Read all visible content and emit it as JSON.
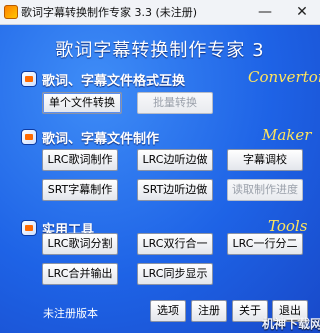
{
  "window": {
    "title": "歌词字幕转换制作专家 3.3 (未注册)",
    "minimize": "—",
    "close": "✕"
  },
  "app_title": "歌词字幕转换制作专家 3",
  "sections": {
    "convertor": {
      "label": "歌词、字幕文件格式互换",
      "english": "Convertor",
      "buttons": {
        "single": "单个文件转换",
        "batch": "批量转换"
      }
    },
    "maker": {
      "label": "歌词、字幕文件制作",
      "english": "Maker",
      "buttons": {
        "lrc_make": "LRC歌词制作",
        "lrc_listen": "LRC边听边做",
        "subtitle_adjust": "字幕调校",
        "srt_make": "SRT字幕制作",
        "srt_listen": "SRT边听边做",
        "read_progress": "读取制作进度"
      }
    },
    "tools": {
      "label": "实用工具",
      "english": "Tools",
      "buttons": {
        "lrc_split": "LRC歌词分割",
        "lrc_two_in_one": "LRC双行合一",
        "lrc_one_to_two": "LRC一行分二",
        "lrc_merge": "LRC合并输出",
        "lrc_sync": "LRC同步显示"
      }
    }
  },
  "footer": {
    "unregistered": "未注册版本",
    "options": "选项",
    "register": "注册",
    "about": "关于",
    "exit": "退出"
  },
  "watermark": "机神下载网"
}
